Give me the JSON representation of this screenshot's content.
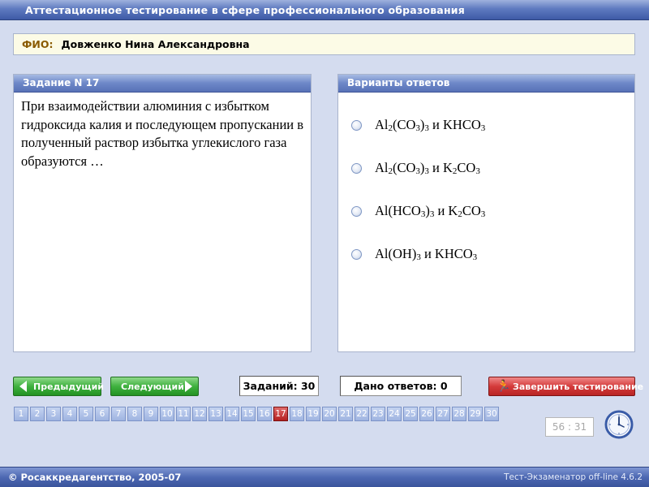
{
  "window": {
    "title": "Аттестационное тестирование в сфере профессионального образования"
  },
  "student": {
    "label": "ФИО:",
    "name": "Довженко Нина Александровна"
  },
  "task": {
    "heading": "Задание N 17",
    "text": "При взаимодействии алюминия с избытком гидроксида калия и последующем пропускании в полученный раствор избытка углекислого газа образуются …"
  },
  "answers": {
    "heading": "Варианты ответов",
    "options": [
      {
        "parts": [
          "Al",
          "2",
          "(CO",
          "3",
          ")",
          "3",
          " и KHCO",
          "3"
        ]
      },
      {
        "parts": [
          "Al",
          "2",
          "(CO",
          "3",
          ")",
          "3",
          " и K",
          "2",
          "CO",
          "3"
        ]
      },
      {
        "parts": [
          "Al(HCO",
          "3",
          ")",
          "3",
          " и K",
          "2",
          "CO",
          "3"
        ]
      },
      {
        "parts": [
          "Al(OH)",
          "3",
          " и KHCO",
          "3"
        ]
      }
    ]
  },
  "controls": {
    "prev_label": "Предыдущий",
    "next_label": "Следующий",
    "tasks_count": "Заданий: 30",
    "answered_count": "Дано ответов: 0",
    "finish_label": "Завершить тестирование"
  },
  "pager": {
    "pages": [
      "1",
      "2",
      "3",
      "4",
      "5",
      "6",
      "7",
      "8",
      "9",
      "10",
      "11",
      "12",
      "13",
      "14",
      "15",
      "16",
      "17",
      "18",
      "19",
      "20",
      "21",
      "22",
      "23",
      "24",
      "25",
      "26",
      "27",
      "28",
      "29",
      "30"
    ],
    "current": "17"
  },
  "timer": {
    "value": "56 : 31"
  },
  "footer": {
    "copyright": "© Росаккредагентство, 2005-07",
    "version": "Тест-Экзаменатор off-line 4.6.2"
  },
  "icons": {
    "prev": "arrow-left-icon",
    "next": "arrow-right-icon",
    "finish": "running-man-icon",
    "clock": "clock-icon"
  },
  "colors": {
    "background": "#d4dcef",
    "header_blue": "#5e7ac0",
    "nav_green": "#3fb13f",
    "finish_red": "#d43b3b",
    "current_page_red": "#b42020"
  }
}
